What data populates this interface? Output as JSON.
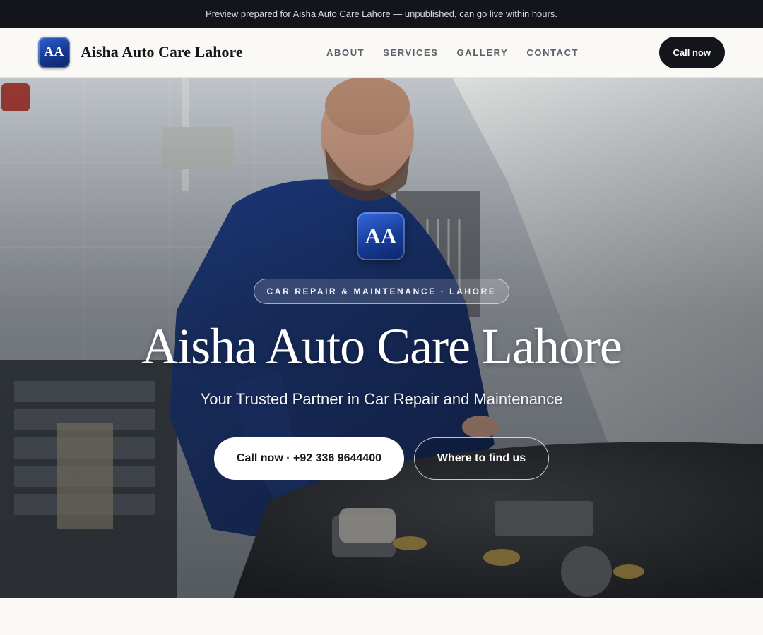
{
  "preview_banner": {
    "text": "Preview prepared for Aisha Auto Care Lahore — unpublished, can go live within hours."
  },
  "header": {
    "logo_initials": "AA",
    "brand_name": "Aisha Auto Care Lahore",
    "nav": [
      "ABOUT",
      "SERVICES",
      "GALLERY",
      "CONTACT"
    ],
    "call_label": "Call now"
  },
  "hero": {
    "logo_initials": "AA",
    "tag": "CAR REPAIR & MAINTENANCE · LAHORE",
    "title": "Aisha Auto Care Lahore",
    "subtitle": "Your Trusted Partner in Car Repair and Maintenance",
    "primary_cta": "Call now · +92 336 9644400",
    "secondary_cta": "Where to find us",
    "image": "mechanic working under open car hood in workshop"
  },
  "colors": {
    "dark": "#13151b",
    "logo_blue": "#1f4bb8",
    "page_bg": "#faf9f6",
    "nav_text": "#5b5f69"
  }
}
